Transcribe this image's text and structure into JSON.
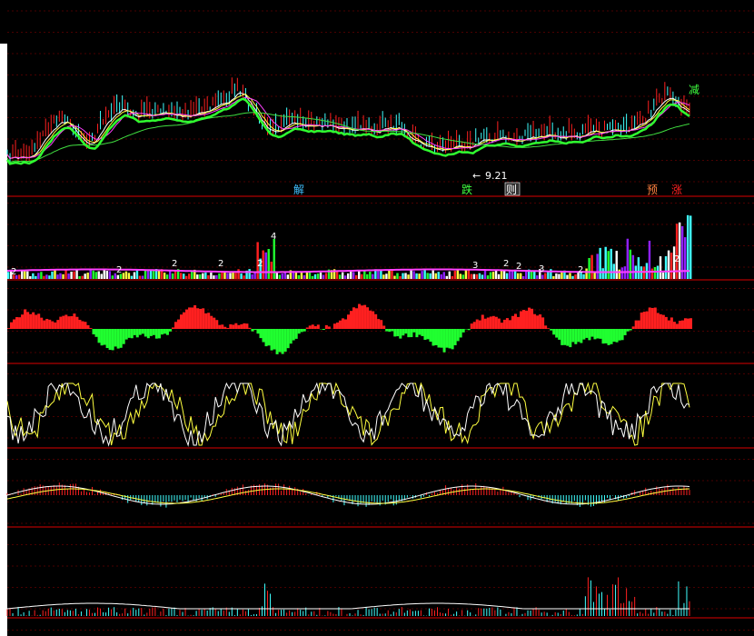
{
  "app": {
    "background": "#000000"
  },
  "signals": {
    "jie": "解",
    "die": "跌",
    "ze": "则",
    "yu": "预",
    "zhang": "涨",
    "jian": "减"
  },
  "price": {
    "low_annotation": "9.21"
  },
  "volume": {
    "markers": [
      "2",
      "2",
      "2",
      "2",
      "2",
      "3",
      "2",
      "2",
      "3",
      "2",
      "2",
      "4"
    ]
  },
  "colors": {
    "up": "#ff2020",
    "down": "#20ff30",
    "ma_white": "#ffffff",
    "ma_yellow": "#ffff40",
    "ma_magenta": "#ff40ff",
    "ma_green": "#40e040",
    "separator": "#b00000",
    "grid": "#4a0000",
    "cyan": "#40ffff",
    "purple": "#9020ff",
    "text_green": "#40ff40"
  }
}
